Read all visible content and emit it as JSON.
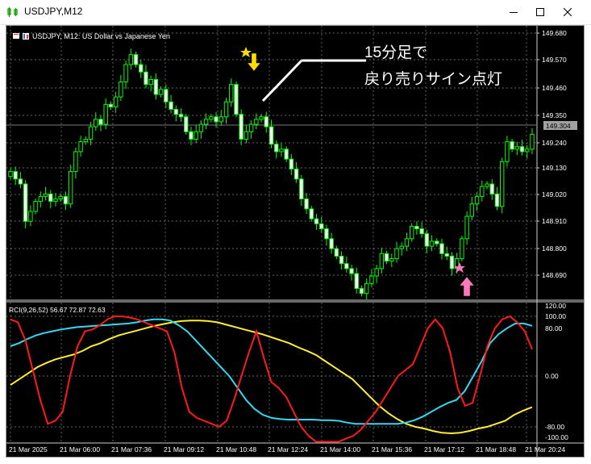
{
  "window": {
    "title": "USDJPY,M12"
  },
  "chart": {
    "info": "USDJPY, M12:  US Dollar vs Japanese Yen",
    "current_price": "149.304",
    "price_ticks": [
      "149.680",
      "149.570",
      "149.460",
      "149.350",
      "149.240",
      "149.130",
      "149.020",
      "148.910",
      "148.800",
      "148.690"
    ],
    "annotation_line1": "15分足で",
    "annotation_line2": "戻り売りサイン点灯"
  },
  "indicator": {
    "label": "RCI(9,26,52) 56.67 72.87 72.63",
    "ticks": [
      "120.00",
      "100.00",
      "80.00",
      "0.00",
      "-80.00",
      "-100.00"
    ],
    "colors": {
      "short": "#ff1a1a",
      "mid": "#33d9ee",
      "long": "#ffee33"
    }
  },
  "time_axis": [
    "21 Mar 2025",
    "21 Mar 06:00",
    "21 Mar 07:36",
    "21 Mar 09:12",
    "21 Mar 10:48",
    "21 Mar 12:24",
    "21 Mar 14:00",
    "21 Mar 15:36",
    "21 Mar 17:12",
    "21 Mar 18:48",
    "21 Mar 20:24"
  ],
  "colors": {
    "bull": "#00ff00",
    "grid": "#8a8a8a",
    "sell_signal": "#ffdd00",
    "buy_signal": "#ff77bb"
  },
  "chart_data": {
    "type": "candlestick",
    "ylim": [
      148.62,
      149.7
    ],
    "closes": [
      149.15,
      149.12,
      149.1,
      148.95,
      148.99,
      149.03,
      149.05,
      149.06,
      149.03,
      149.04,
      149.05,
      149.02,
      149.15,
      149.23,
      149.27,
      149.28,
      149.33,
      149.36,
      149.34,
      149.42,
      149.41,
      149.45,
      149.51,
      149.58,
      149.62,
      149.58,
      149.55,
      149.5,
      149.52,
      149.46,
      149.48,
      149.43,
      149.4,
      149.38,
      149.37,
      149.31,
      149.28,
      149.31,
      149.34,
      149.36,
      149.37,
      149.35,
      149.37,
      149.43,
      149.5,
      149.38,
      149.28,
      149.31,
      149.34,
      149.36,
      149.37,
      149.33,
      149.26,
      149.23,
      149.24,
      149.2,
      149.16,
      149.12,
      149.04,
      149.0,
      148.96,
      148.94,
      148.92,
      148.88,
      148.84,
      148.81,
      148.78,
      148.76,
      148.74,
      148.68,
      148.66,
      148.7,
      148.73,
      148.76,
      148.82,
      148.79,
      148.8,
      148.84,
      148.85,
      148.88,
      148.93,
      148.92,
      148.9,
      148.85,
      148.87,
      148.86,
      148.82,
      148.81,
      148.76,
      148.8,
      148.88,
      148.97,
      149.02,
      149.05,
      149.09,
      149.1,
      149.06,
      149.01,
      149.19,
      149.27,
      149.24,
      149.25,
      149.23,
      149.24,
      149.3
    ]
  }
}
